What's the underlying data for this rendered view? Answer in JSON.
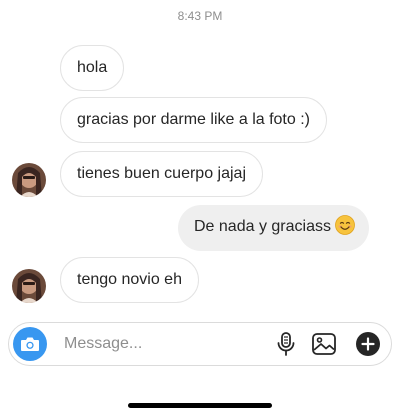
{
  "status": {
    "time": "8:43 PM"
  },
  "messages": [
    {
      "text": "hola",
      "direction": "incoming"
    },
    {
      "text": "gracias por darme like a la foto :)",
      "direction": "incoming"
    },
    {
      "text": "tienes buen cuerpo jajaj",
      "direction": "incoming",
      "avatar": true
    },
    {
      "text": "De nada y graciass",
      "direction": "outgoing",
      "emoji": "smiling-face-emoji"
    },
    {
      "text": "tengo novio eh",
      "direction": "incoming",
      "avatar": true
    }
  ],
  "composer": {
    "placeholder": "Message...",
    "icons": [
      "camera-icon",
      "microphone-icon",
      "gallery-icon",
      "plus-icon"
    ]
  },
  "colors": {
    "accent": "#3897f0",
    "incoming_border": "#e3e3e3",
    "outgoing_bg": "#efefef",
    "muted_text": "#8e8e8e"
  }
}
